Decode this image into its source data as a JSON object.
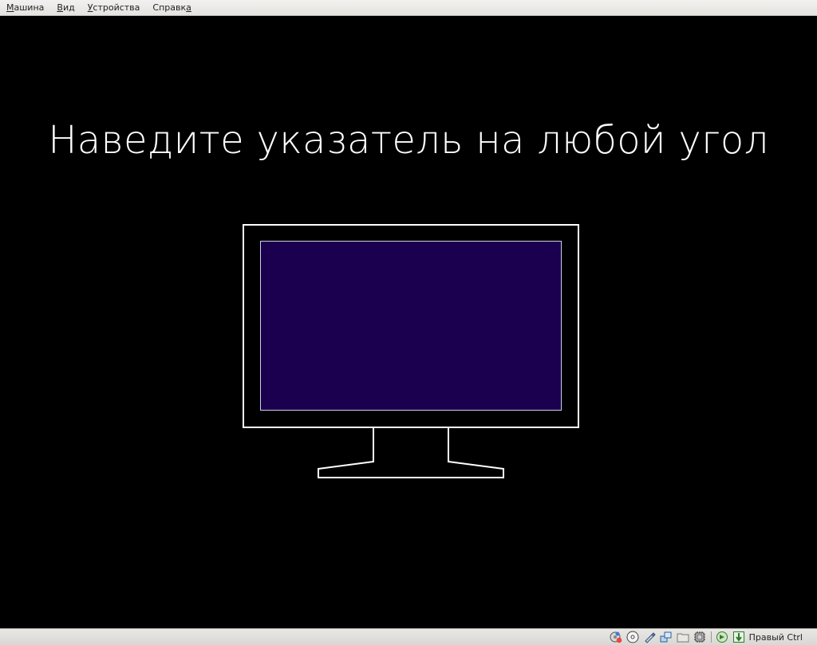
{
  "menubar": {
    "items": [
      {
        "mnemonic": "М",
        "rest": "ашина"
      },
      {
        "mnemonic": "В",
        "rest": "ид"
      },
      {
        "mnemonic": "У",
        "rest": "стройства"
      },
      {
        "pre": "Справк",
        "mnemonic": "а"
      }
    ]
  },
  "screen": {
    "headline": "Наведите указатель на любой угол",
    "monitor_fill_color": "#1a004f",
    "monitor_line_color": "#ffffff"
  },
  "statusbar": {
    "icons": [
      "hard-disk-icon",
      "optical-drive-icon",
      "usb-icon",
      "network-icon",
      "shared-folders-icon",
      "cpu-icon",
      "video-capture-icon",
      "mouse-integration-icon"
    ],
    "host_key": "Правый Ctrl"
  }
}
